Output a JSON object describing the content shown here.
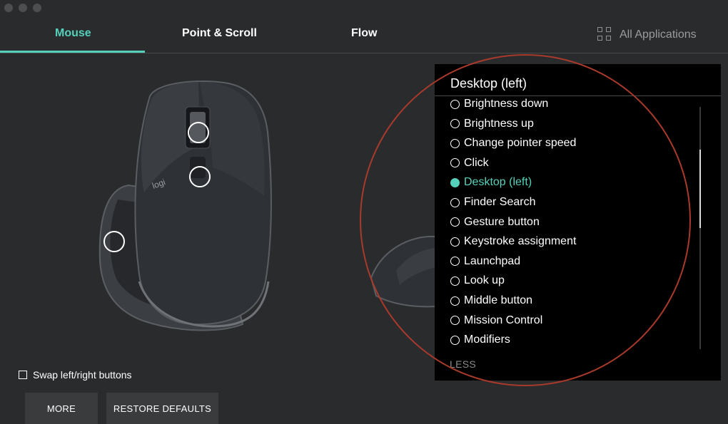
{
  "tabs": [
    {
      "label": "Mouse",
      "active": true
    },
    {
      "label": "Point & Scroll",
      "active": false
    },
    {
      "label": "Flow",
      "active": false
    }
  ],
  "all_applications": {
    "label": "All Applications",
    "icon": "grid-icon"
  },
  "mouse": {
    "logo_text": "logi"
  },
  "swap_buttons": {
    "label": "Swap left/right buttons",
    "checked": false
  },
  "buttons": {
    "more": "MORE",
    "restore": "RESTORE DEFAULTS"
  },
  "dropdown": {
    "title": "Desktop (left)",
    "items": [
      {
        "label": "Brightness down",
        "selected": false
      },
      {
        "label": "Brightness up",
        "selected": false
      },
      {
        "label": "Change pointer speed",
        "selected": false
      },
      {
        "label": "Click",
        "selected": false
      },
      {
        "label": "Desktop (left)",
        "selected": true
      },
      {
        "label": "Finder Search",
        "selected": false
      },
      {
        "label": "Gesture button",
        "selected": false
      },
      {
        "label": "Keystroke assignment",
        "selected": false
      },
      {
        "label": "Launchpad",
        "selected": false
      },
      {
        "label": "Look up",
        "selected": false
      },
      {
        "label": "Middle button",
        "selected": false
      },
      {
        "label": "Mission Control",
        "selected": false
      },
      {
        "label": "Modifiers",
        "selected": false
      }
    ],
    "less_label": "LESS"
  },
  "colors": {
    "accent": "#55d1bb",
    "background": "#2a2b2d",
    "annotation": "#a83a2c"
  }
}
